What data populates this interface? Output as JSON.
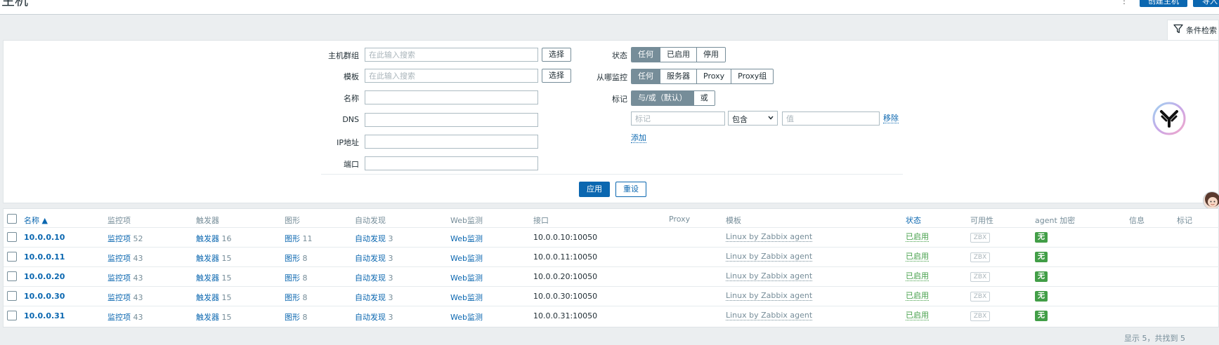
{
  "header": {
    "title": "主机",
    "create_host_label": "创建主机",
    "import_label": "导入"
  },
  "filter": {
    "tab_label": "条件检索",
    "host_groups_label": "主机群组",
    "host_groups_placeholder": "在此输入搜索",
    "templates_label": "模板",
    "templates_placeholder": "在此输入搜索",
    "select_label": "选择",
    "name_label": "名称",
    "dns_label": "DNS",
    "ip_label": "IP地址",
    "port_label": "端口",
    "status_label": "状态",
    "status_options": [
      "任何",
      "已启用",
      "停用"
    ],
    "monitored_by_label": "从哪监控",
    "monitored_by_options": [
      "任何",
      "服务器",
      "Proxy",
      "Proxy组"
    ],
    "tags_label": "标记",
    "tags_mode_options": [
      "与/或（默认）",
      "或"
    ],
    "tag_placeholder": "标记",
    "tag_operator": "包含",
    "tag_value_placeholder": "值",
    "remove_label": "移除",
    "add_label": "添加",
    "apply_label": "应用",
    "reset_label": "重设"
  },
  "table": {
    "columns": [
      "名称 ▲",
      "监控项",
      "触发器",
      "图形",
      "自动发现",
      "Web监测",
      "接口",
      "Proxy",
      "模板",
      "状态",
      "可用性",
      "agent 加密",
      "信息",
      "标记"
    ],
    "rows": [
      {
        "name": "10.0.0.10",
        "items_label": "监控项",
        "items": "52",
        "triggers_label": "触发器",
        "triggers": "16",
        "graphs_label": "图形",
        "graphs": "11",
        "discovery_label": "自动发现",
        "discovery": "3",
        "web": "Web监测",
        "interface": "10.0.0.10:10050",
        "template": "Linux by Zabbix agent",
        "status": "已启用",
        "availability": "ZBX",
        "encryption": "无"
      },
      {
        "name": "10.0.0.11",
        "items_label": "监控项",
        "items": "43",
        "triggers_label": "触发器",
        "triggers": "15",
        "graphs_label": "图形",
        "graphs": "8",
        "discovery_label": "自动发现",
        "discovery": "3",
        "web": "Web监测",
        "interface": "10.0.0.11:10050",
        "template": "Linux by Zabbix agent",
        "status": "已启用",
        "availability": "ZBX",
        "encryption": "无"
      },
      {
        "name": "10.0.0.20",
        "items_label": "监控项",
        "items": "43",
        "triggers_label": "触发器",
        "triggers": "15",
        "graphs_label": "图形",
        "graphs": "8",
        "discovery_label": "自动发现",
        "discovery": "3",
        "web": "Web监测",
        "interface": "10.0.0.20:10050",
        "template": "Linux by Zabbix agent",
        "status": "已启用",
        "availability": "ZBX",
        "encryption": "无"
      },
      {
        "name": "10.0.0.30",
        "items_label": "监控项",
        "items": "43",
        "triggers_label": "触发器",
        "triggers": "15",
        "graphs_label": "图形",
        "graphs": "8",
        "discovery_label": "自动发现",
        "discovery": "3",
        "web": "Web监测",
        "interface": "10.0.0.30:10050",
        "template": "Linux by Zabbix agent",
        "status": "已启用",
        "availability": "ZBX",
        "encryption": "无"
      },
      {
        "name": "10.0.0.31",
        "items_label": "监控项",
        "items": "43",
        "triggers_label": "触发器",
        "triggers": "15",
        "graphs_label": "图形",
        "graphs": "8",
        "discovery_label": "自动发现",
        "discovery": "3",
        "web": "Web监测",
        "interface": "10.0.0.31:10050",
        "template": "Linux by Zabbix agent",
        "status": "已启用",
        "availability": "ZBX",
        "encryption": "无"
      }
    ],
    "footer": "显示 5，共找到 5"
  },
  "icons": {
    "filter": "filter-funnel-icon",
    "kebab": "kebab-menu-icon",
    "logo": "zabbix-logo-icon",
    "avatar": "assistant-avatar-icon"
  },
  "colors": {
    "primary": "#0b67b0",
    "segment_active": "#768d99",
    "enabled": "#429e47",
    "page_bg": "#ebeef0"
  }
}
